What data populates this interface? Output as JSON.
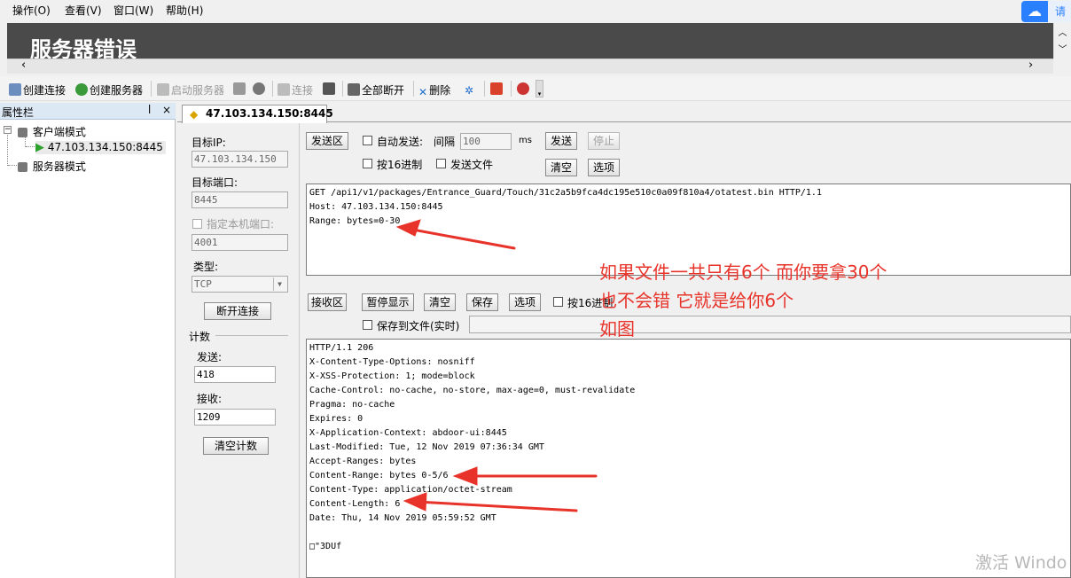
{
  "menu": [
    "操作(O)",
    "查看(V)",
    "窗口(W)",
    "帮助(H)"
  ],
  "cloud_text": "请",
  "error_title": "服务器错误",
  "toolbar": {
    "create_connection": "创建连接",
    "create_server": "创建服务器",
    "start_server": "启动服务器",
    "connect": "连接",
    "disconnect_all": "全部断开",
    "delete": "删除"
  },
  "sidebar": {
    "title": "属性栏",
    "pin": "ᵖ",
    "close": "×",
    "client_mode": "客户端模式",
    "connection": "47.103.134.150:8445",
    "server_mode": "服务器模式"
  },
  "tab": {
    "label": "47.103.134.150:8445"
  },
  "left": {
    "target_ip_label": "目标IP:",
    "target_ip": "47.103.134.150",
    "target_port_label": "目标端口:",
    "target_port": "8445",
    "local_port_label": "指定本机端口:",
    "local_port": "4001",
    "type_label": "类型:",
    "type_value": "TCP",
    "disconnect_button": "断开连接",
    "count_label": "计数",
    "send_label": "发送:",
    "send_count": "418",
    "recv_label": "接收:",
    "recv_count": "1209",
    "clear_count_button": "清空计数"
  },
  "send": {
    "area_label": "发送区",
    "auto_send": "自动发送:",
    "interval_label": "间隔",
    "interval_value": "100",
    "interval_unit": "ms",
    "send_button": "发送",
    "stop_button": "停止",
    "hex_label": "按16进制",
    "send_file_label": "发送文件",
    "clear_button": "清空",
    "options_button": "选项",
    "content": "GET /api1/v1/packages/Entrance_Guard/Touch/31c2a5b9fca4dc195e510c0a09f810a4/otatest.bin HTTP/1.1\nHost: 47.103.134.150:8445\nRange: bytes=0-30"
  },
  "recv": {
    "area_label": "接收区",
    "pause_button": "暂停显示",
    "clear_button": "清空",
    "save_button": "保存",
    "options_button": "选项",
    "hex_label": "按16进制",
    "save_realtime_label": "保存到文件(实时)",
    "content": "HTTP/1.1 206\nX-Content-Type-Options: nosniff\nX-XSS-Protection: 1; mode=block\nCache-Control: no-cache, no-store, max-age=0, must-revalidate\nPragma: no-cache\nExpires: 0\nX-Application-Context: abdoor-ui:8445\nLast-Modified: Tue, 12 Nov 2019 07:36:34 GMT\nAccept-Ranges: bytes\nContent-Range: bytes 0-5/6\nContent-Type: application/octet-stream\nContent-Length: 6\nDate: Thu, 14 Nov 2019 05:59:52 GMT\n\n□\"3DUf"
  },
  "annotation": [
    "如果文件一共只有6个 而你要拿30个",
    "也不会错 它就是给你6个",
    "如图"
  ],
  "watermark": "激活 Windo",
  "colors": {
    "accent_red": "#e8332a",
    "error_panel": "#4a4a4a",
    "sidebar_header": "#dde8f5"
  }
}
